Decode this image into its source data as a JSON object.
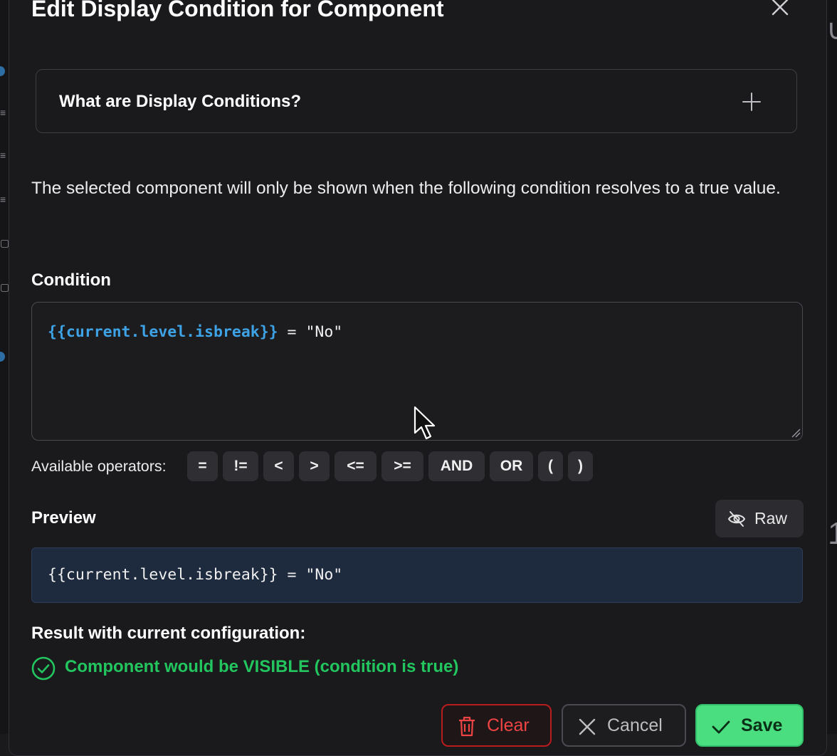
{
  "modal": {
    "title": "Edit Display Condition for Component",
    "accordion_label": "What are Display Conditions?",
    "description": "The selected component will only be shown when the following condition resolves to a true value."
  },
  "condition": {
    "label": "Condition",
    "variable": "{{current.level.isbreak}}",
    "rest": " = \"No\""
  },
  "operators": {
    "label": "Available operators:",
    "items": [
      "=",
      "!=",
      "<",
      ">",
      "<=",
      ">=",
      "AND",
      "OR",
      "(",
      ")"
    ]
  },
  "preview": {
    "label": "Preview",
    "raw_label": "Raw",
    "code": "{{current.level.isbreak}} = \"No\""
  },
  "result": {
    "label": "Result with current configuration:",
    "text": "Component would be VISIBLE (condition is true)"
  },
  "buttons": {
    "clear": "Clear",
    "cancel": "Cancel",
    "save": "Save"
  },
  "colors": {
    "background": "#1a1a1d",
    "variable_token": "#3ea3e6",
    "success": "#22c55e",
    "save_button": "#4ade80",
    "clear_button": "#ef4444",
    "preview_bg": "#1e2a3d"
  },
  "icons": [
    "close-icon",
    "plus-icon",
    "eye-off-icon",
    "check-circle-icon",
    "trash-icon",
    "x-icon",
    "check-icon"
  ]
}
